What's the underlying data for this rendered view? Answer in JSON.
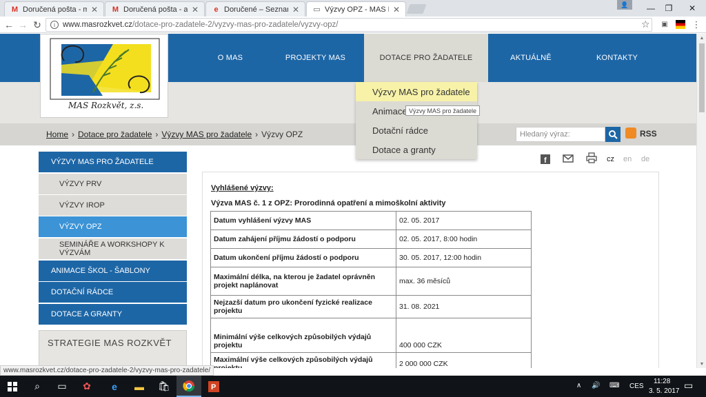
{
  "browser": {
    "tabs": [
      {
        "title": "Doručená pošta - mitaso",
        "icon": "gmail-icon",
        "icon_char": "M",
        "icon_color": "#d93025"
      },
      {
        "title": "Doručená pošta - asisten",
        "icon": "gmail-icon",
        "icon_char": "M",
        "icon_color": "#d93025"
      },
      {
        "title": "Doručené – Seznam Ema",
        "icon": "seznam-icon",
        "icon_char": "e",
        "icon_color": "#e0341e"
      },
      {
        "title": "Výzvy OPZ - MAS Rozkvě",
        "icon": "page-icon",
        "icon_char": "▭",
        "icon_color": "#666666"
      }
    ],
    "url_domain": "www.masrozkvet.cz",
    "url_path": "/dotace-pro-zadatele-2/vyzvy-mas-pro-zadatele/vyzvy-opz/",
    "status_url": "www.masrozkvet.cz/dotace-pro-zadatele-2/vyzvy-mas-pro-zadatele/"
  },
  "site": {
    "logo_text": "MAS Rozkvět, z.s.",
    "nav": [
      "O MAS",
      "PROJEKTY MAS",
      "DOTACE PRO ŽADATELE",
      "AKTUÁLNĚ",
      "KONTAKTY"
    ],
    "dropdown": [
      "Výzvy MAS pro žadatele",
      "Animace",
      "Dotační rádce",
      "Dotace a granty"
    ],
    "tooltip": "Výzvy MAS pro žadatele",
    "breadcrumb": [
      "Home",
      "Dotace pro žadatele",
      "Výzvy MAS pro žadatele",
      "Výzvy OPZ"
    ],
    "search_placeholder": "Hledaný výraz:",
    "rss": "RSS",
    "langs": [
      "cz",
      "en",
      "de"
    ]
  },
  "sidebar": {
    "items": [
      "VÝZVY MAS PRO ŽADATELE",
      "VÝZVY PRV",
      "VÝZVY IROP",
      "VÝZVY OPZ",
      "SEMINÁŘE A WORKSHOPY K VÝZVÁM",
      "ANIMACE ŠKOL - ŠABLONY",
      "DOTAČNÍ RÁDCE",
      "DOTACE A GRANTY"
    ],
    "strategie": "STRATEGIE MAS ROZKVĚT"
  },
  "content": {
    "heading": "Vyhlášené výzvy:",
    "title": "Výzva MAS č. 1 z OPZ: Prorodinná opatření a mimoškolní aktivity",
    "rows": [
      {
        "k": "Datum vyhlášení výzvy MAS",
        "v": "02. 05. 2017"
      },
      {
        "k": "Datum zahájení příjmu žádostí o podporu",
        "v": "02. 05. 2017, 8:00 hodin"
      },
      {
        "k": "Datum ukončení příjmu žádostí o podporu",
        "v": "30. 05. 2017, 12:00 hodin"
      },
      {
        "k": "Maximální délka, na kterou je žadatel oprávněn projekt naplánovat",
        "v": "max. 36 měsíců"
      },
      {
        "k": "Nejzazší datum pro ukončení fyzické realizace projektu",
        "v": "31. 08. 2021"
      },
      {
        "k": "Minimální výše celkových způsobilých výdajů projektu",
        "v": "400 000 CZK"
      },
      {
        "k": "Maximální výše celkových způsobilých výdajů projektu",
        "v": "2 000 000 CZK"
      }
    ]
  },
  "taskbar": {
    "lang": "CES",
    "time": "11:28",
    "date": "3. 5. 2017"
  }
}
